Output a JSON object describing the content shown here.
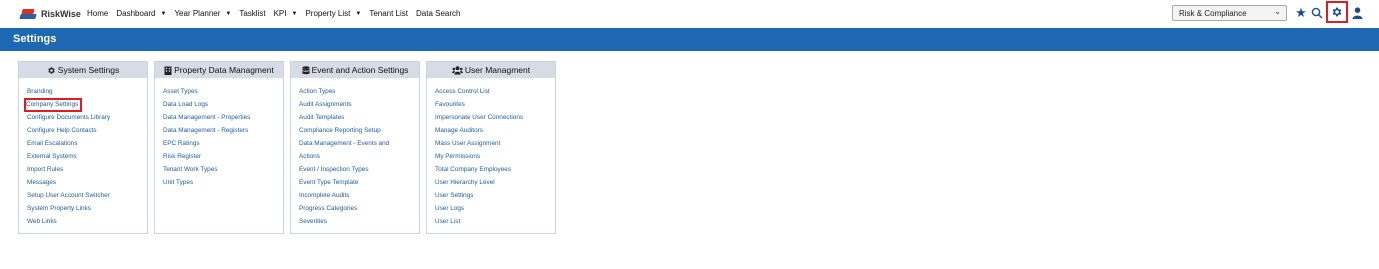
{
  "app": {
    "logo_text": "RiskWise"
  },
  "nav": [
    {
      "label": "Home",
      "dropdown": false
    },
    {
      "label": "Dashboard",
      "dropdown": true
    },
    {
      "label": "Year Planner",
      "dropdown": true
    },
    {
      "label": "Tasklist",
      "dropdown": false
    },
    {
      "label": "KPI",
      "dropdown": true
    },
    {
      "label": "Property List",
      "dropdown": true
    },
    {
      "label": "Tenant List",
      "dropdown": false
    },
    {
      "label": "Data Search",
      "dropdown": false
    }
  ],
  "module_select": {
    "value": "Risk & Compliance"
  },
  "page": {
    "title": "Settings"
  },
  "panels": [
    {
      "title": "System Settings",
      "icon": "gear-icon",
      "items": [
        "Branding",
        "Company Settings",
        "Configure Documents Library",
        "Configure Help Contacts",
        "Email Escalations",
        "External Systems",
        "Import Rules",
        "Messages",
        "Setup User Account Switcher",
        "System Property Links",
        "Web Links"
      ]
    },
    {
      "title": "Property Data Managment",
      "icon": "building-icon",
      "items": [
        "Asset Types",
        "Data Load Logs",
        "Data Management - Properties",
        "Data Management - Registers",
        "EPC Ratings",
        "Risk Register",
        "Tenant Work Types",
        "Unit Types"
      ]
    },
    {
      "title": "Event and Action Settings",
      "icon": "database-icon",
      "items": [
        "Action Types",
        "Audit Assignments",
        "Audit Templates",
        "Compliance Reporting Setup",
        "Data Management - Events and Actions",
        "Event / Inspection Types",
        "Event Type Template",
        "Incomplete Audits",
        "Progress Categories",
        "Severities"
      ]
    },
    {
      "title": "User Managment",
      "icon": "users-icon",
      "items": [
        "Access Control List",
        "Favourites",
        "Impersonate User Connections",
        "Manage Auditors",
        "Mass User Assignment",
        "My Permissions",
        "Total Company Employees",
        "User Hierarchy Level",
        "User Settings",
        "User Logs",
        "User List"
      ]
    }
  ],
  "colors": {
    "accent": "#1e67b3",
    "link": "#1e5ea8",
    "highlight": "#e01b24",
    "panel_header": "#d6dce6"
  }
}
